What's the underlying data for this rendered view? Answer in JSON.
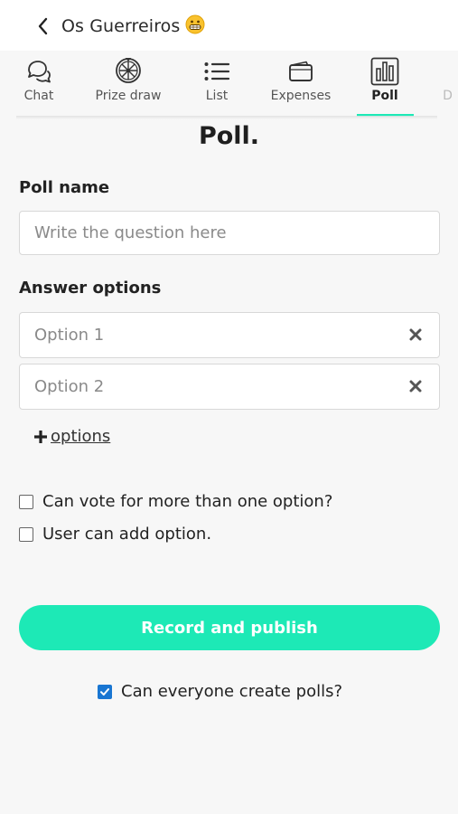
{
  "header": {
    "title": "Os Guerreiros",
    "emoji_icon": "grinning-face-icon"
  },
  "tabs": [
    {
      "label": "Chat",
      "icon": "chat-bubbles-icon",
      "active": false
    },
    {
      "label": "Prize draw",
      "icon": "prize-wheel-icon",
      "active": false
    },
    {
      "label": "List",
      "icon": "list-icon",
      "active": false
    },
    {
      "label": "Expenses",
      "icon": "wallet-icon",
      "active": false
    },
    {
      "label": "Poll",
      "icon": "bar-chart-icon",
      "active": true
    },
    {
      "label": "D",
      "icon": "",
      "active": false
    }
  ],
  "colors": {
    "accent": "#1de9b6",
    "checkbox_checked": "#1976d2",
    "background": "#f7f7f7"
  },
  "page": {
    "title": "Poll."
  },
  "poll_name": {
    "label": "Poll name",
    "placeholder": "Write the question here"
  },
  "answer_options": {
    "label": "Answer options",
    "options": [
      {
        "placeholder": "Option 1"
      },
      {
        "placeholder": "Option 2"
      }
    ],
    "add_label": " options"
  },
  "settings": {
    "multi_vote": {
      "label": "Can vote for more than one option?",
      "checked": false
    },
    "user_add_option": {
      "label": "User can add option.",
      "checked": false
    }
  },
  "publish_button": "Record and publish",
  "everyone_create": {
    "label": "Can everyone create polls?",
    "checked": true
  }
}
